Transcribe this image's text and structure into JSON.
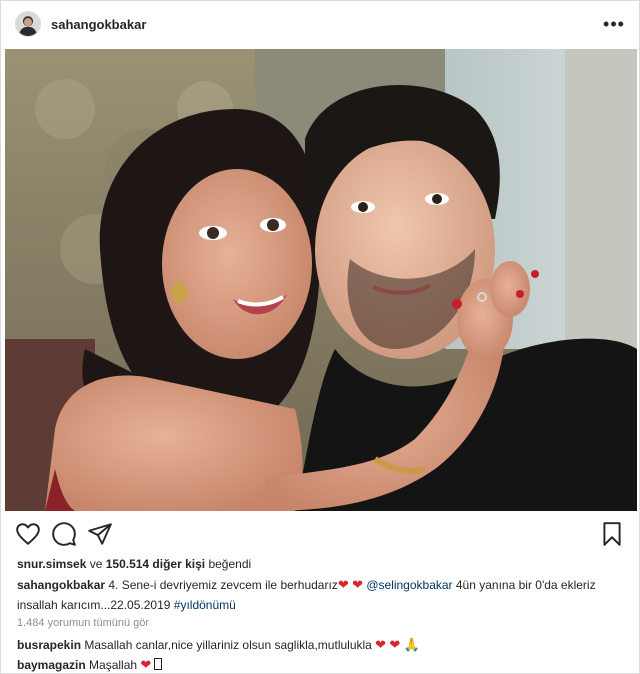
{
  "header": {
    "username": "sahangokbakar",
    "more_label": "•••"
  },
  "photo": {
    "alt": "sahangokbakar post photo"
  },
  "actions": {
    "icons": [
      "heart-icon",
      "comment-icon",
      "share-icon",
      "bookmark-icon"
    ]
  },
  "likes": {
    "first_user": "snur.simsek",
    "connector": " ve ",
    "count_text": "150.514 diğer kişi",
    "suffix": " beğendi"
  },
  "caption": {
    "author": "sahangokbakar",
    "text_part1": " 4. Sene-i devriyemiz zevcem ile berhudarız",
    "emoji1": "❤",
    "emoji2": "❤",
    "mention": "@selingokbakar",
    "text_part2": " 4ün yanına bir 0'da ekleriz insallah karıcım...22.05.2019 ",
    "hashtag": "#yıldönümü"
  },
  "view_comments": "1.484 yorumun tümünü gör",
  "comments": [
    {
      "author": "busrapekin",
      "text": " Masallah canlar,nice yillariniz olsun saglikla,mutlulukla ",
      "emoji1": "❤",
      "emoji2": "❤",
      "emoji3": "🙏"
    },
    {
      "author": "baymagazin",
      "text": " Maşallah ",
      "emoji1": "❤"
    }
  ],
  "colors": {
    "heart": "#d7262e",
    "link": "#003569",
    "muted": "#8e8e8e",
    "text": "#262626"
  }
}
